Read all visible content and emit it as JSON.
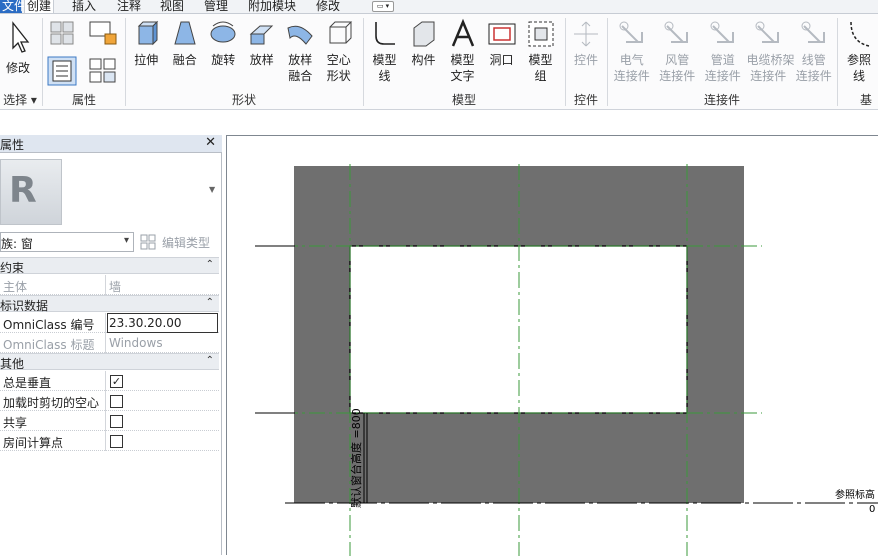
{
  "tabs": [
    {
      "label": "文件",
      "state": "blue"
    },
    {
      "label": "创建",
      "state": "active"
    },
    {
      "label": "插入",
      "state": ""
    },
    {
      "label": "注释",
      "state": ""
    },
    {
      "label": "视图",
      "state": ""
    },
    {
      "label": "管理",
      "state": ""
    },
    {
      "label": "附加模块",
      "state": ""
    },
    {
      "label": "修改",
      "state": ""
    }
  ],
  "ribbon": {
    "select": {
      "modify_label": "修改",
      "panel": "选择"
    },
    "properties": {
      "panel": "属性"
    },
    "forms": {
      "panel": "形状",
      "tools": [
        "拉伸",
        "融合",
        "旋转",
        "放样",
        "放样\n融合",
        "空心\n形状"
      ]
    },
    "model": {
      "panel": "模型",
      "tools": [
        "模型\n线",
        "构件",
        "模型\n文字",
        "洞口",
        "模型\n组"
      ]
    },
    "control": {
      "panel": "控件",
      "tools": [
        "控件"
      ]
    },
    "connectors": {
      "panel": "连接件",
      "tools": [
        "电气\n连接件",
        "风管\n连接件",
        "管道\n连接件",
        "电缆桥架\n连接件",
        "线管\n连接件"
      ]
    },
    "datum": {
      "panel": "基",
      "tools": [
        "参照\n线"
      ]
    }
  },
  "properties": {
    "title": "属性",
    "preview_letter": "R",
    "family_select": "族: 窗",
    "edit_type": "编辑类型",
    "groups": [
      {
        "name": "约束",
        "rows": [
          {
            "k": "主体",
            "v": "墙",
            "type": "grey"
          }
        ]
      },
      {
        "name": "标识数据",
        "rows": [
          {
            "k": "OmniClass 编号",
            "v": "23.30.20.00",
            "type": "edit"
          },
          {
            "k": "OmniClass 标题",
            "v": "Windows",
            "type": "grey"
          }
        ]
      },
      {
        "name": "其他",
        "rows": [
          {
            "k": "总是垂直",
            "v": "",
            "type": "check",
            "checked": true
          },
          {
            "k": "加载时剪切的空心",
            "v": "",
            "type": "check",
            "checked": false
          },
          {
            "k": "共享",
            "v": "",
            "type": "check",
            "checked": false
          },
          {
            "k": "房间计算点",
            "v": "",
            "type": "check",
            "checked": false
          }
        ]
      }
    ]
  },
  "view": {
    "dim_text": "默认窗台高度 =800",
    "level_name": "参照标高",
    "level_value": "0",
    "wall_color": "#6f6f6f",
    "refplane_color": "#3b9a3b"
  }
}
